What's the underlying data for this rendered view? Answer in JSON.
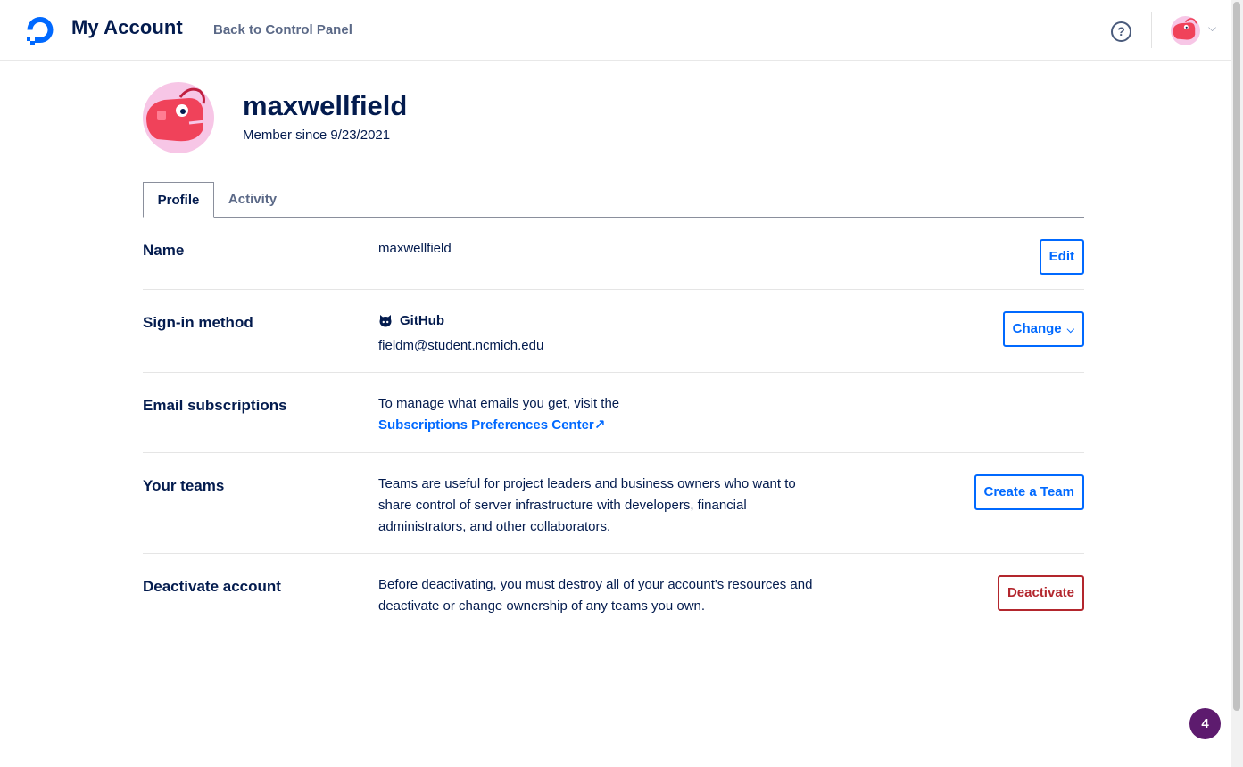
{
  "header": {
    "title": "My Account",
    "back_link": "Back to Control Panel",
    "help_symbol": "?",
    "menu_chevron": "⌵"
  },
  "profile": {
    "username": "maxwellfield",
    "member_since": "Member since 9/23/2021"
  },
  "tabs": [
    {
      "label": "Profile",
      "active": true
    },
    {
      "label": "Activity",
      "active": false
    }
  ],
  "rows": {
    "name": {
      "label": "Name",
      "value": "maxwellfield",
      "button": "Edit"
    },
    "signin": {
      "label": "Sign-in method",
      "provider": "GitHub",
      "email": "fieldm@student.ncmich.edu",
      "button": "Change",
      "chevron": "⌵"
    },
    "email_subs": {
      "label": "Email subscriptions",
      "text": "To manage what emails you get, visit the",
      "link": "Subscriptions Preferences Center",
      "link_icon": "↗"
    },
    "teams": {
      "label": "Your teams",
      "line1": "Teams are useful for project leaders and business owners who want to",
      "line2": "share control of server infrastructure with developers, financial",
      "line3": "administrators, and other collaborators.",
      "button": "Create a Team"
    },
    "deactivate": {
      "label": "Deactivate account",
      "line1": "Before deactivating, you must destroy all of your account's resources and",
      "line2": "deactivate or change ownership of any teams you own.",
      "button": "Deactivate"
    }
  },
  "notification_badge": "4",
  "colors": {
    "primary": "#0069ff",
    "navy": "#031b4e",
    "danger": "#b3262d",
    "badge": "#5d1b6e",
    "avatar_bg": "#f7c6e6",
    "avatar_face": "#f0425a"
  }
}
